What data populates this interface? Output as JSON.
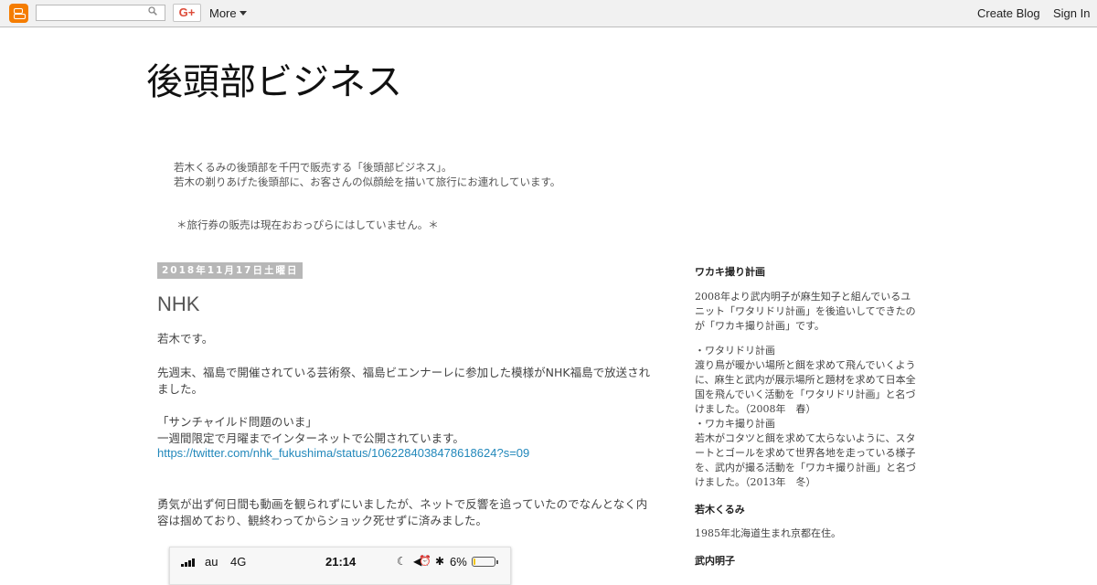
{
  "navbar": {
    "more_label": "More",
    "gplus_label": "G+",
    "create_blog": "Create Blog",
    "sign_in": "Sign In"
  },
  "header": {
    "title": "後頭部ビジネス",
    "description_lines": [
      "若木くるみの後頭部を千円で販売する「後頭部ビジネス」。",
      "若木の剃りあげた後頭部に、お客さんの似顔絵を描いて旅行にお連れしています。",
      "＊旅行券の販売は現在おおっぴらにはしていません。＊"
    ]
  },
  "post": {
    "date": "2018年11月17日土曜日",
    "title": "NHK",
    "paragraphs": [
      "若木です。",
      "先週末、福島で開催されている芸術祭、福島ビエンナーレに参加した模様がNHK福島で放送されました。",
      "「サンチャイルド問題のいま」\n一週間限定で月曜までインターネットで公開されています。",
      "勇気が出ず何日間も動画を観られずにいましたが、ネットで反響を追っていたのでなんとなく内容は掴めており、観終わってからショック死せずに済みました。"
    ],
    "link": "https://twitter.com/nhk_fukushima/status/1062284038478618624?s=09"
  },
  "phone_status": {
    "carrier": "au",
    "network": "4G",
    "time": "21:14",
    "battery_text": "6%",
    "battery_level": 0.06
  },
  "sidebar": {
    "sections": [
      {
        "heading": "ワカキ撮り計画",
        "texts": [
          "2008年より武内明子が麻生知子と組んでいるユニット「ワタリドリ計画」を後追いしてできたのが「ワカキ撮り計画」です。",
          "・ワタリドリ計画\n渡り鳥が暖かい場所と餌を求めて飛んでいくように、麻生と武内が展示場所と題材を求めて日本全国を飛んでいく活動を「ワタリドリ計画」と名づけました。（2008年　春）\n・ワカキ撮り計画\n若木がコタツと餌を求めて太らないように、スタートとゴールを求めて世界各地を走っている様子を、武内が撮る活動を「ワカキ撮り計画」と名づけました。（2013年　冬）"
        ]
      },
      {
        "heading": "若木くるみ",
        "texts": [
          "1985年北海道生まれ京都在住。"
        ]
      },
      {
        "heading": "武内明子",
        "texts": []
      }
    ]
  }
}
